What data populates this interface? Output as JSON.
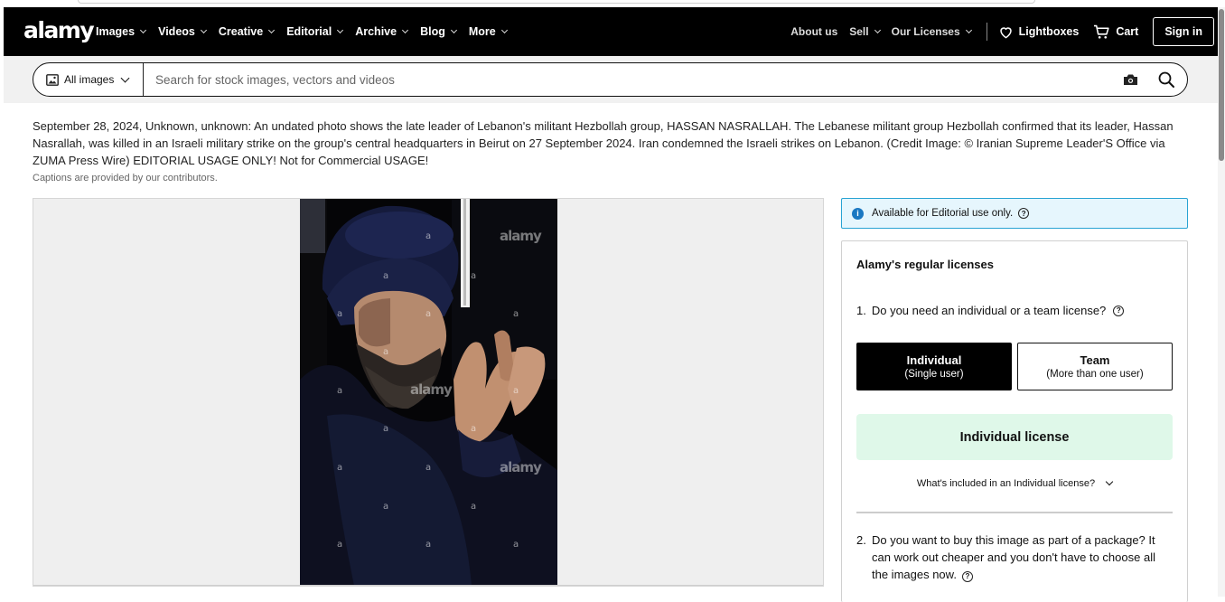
{
  "header": {
    "logo": "alamy",
    "nav_left": [
      "Images",
      "Videos",
      "Creative",
      "Editorial",
      "Archive",
      "Blog",
      "More"
    ],
    "nav_right": [
      "About us",
      "Sell",
      "Our Licenses"
    ],
    "lightboxes": "Lightboxes",
    "cart": "Cart",
    "signin": "Sign in"
  },
  "search": {
    "filter_label": "All images",
    "placeholder": "Search for stock images, vectors and videos"
  },
  "caption": {
    "text": "September 28, 2024, Unknown, unknown: An undated photo shows the late leader of Lebanon's militant Hezbollah group, HASSAN NASRALLAH. The Lebanese militant group Hezbollah confirmed that its leader, Hassan Nasrallah, was killed in an Israeli military strike on the group's central headquarters in Beirut on 27 September 2024. Iran condemned the Israeli strikes on Lebanon. (Credit Image: © Iranian Supreme Leader'S Office via ZUMA Press Wire) EDITORIAL USAGE ONLY! Not for Commercial USAGE!",
    "note": "Captions are provided by our contributors."
  },
  "image": {
    "watermark": "alamy",
    "watermark_letter": "a"
  },
  "license": {
    "notice": "Available for Editorial use only.",
    "title": "Alamy's regular licenses",
    "q1_num": "1.",
    "q1": "Do you need an individual or a team license?",
    "individual_title": "Individual",
    "individual_sub": "(Single user)",
    "team_title": "Team",
    "team_sub": "(More than one user)",
    "selected_license": "Individual license",
    "whats_included": "What's included in an Individual license?",
    "q2_num": "2.",
    "q2": "Do you want to buy this image as part of a package? It can work out cheaper and you don't have to choose all the images now."
  },
  "colors": {
    "nav_bg": "#000000",
    "notice_bg": "#e6f6fd",
    "notice_border": "#28a3d3",
    "license_box_bg": "#dff8e9"
  }
}
